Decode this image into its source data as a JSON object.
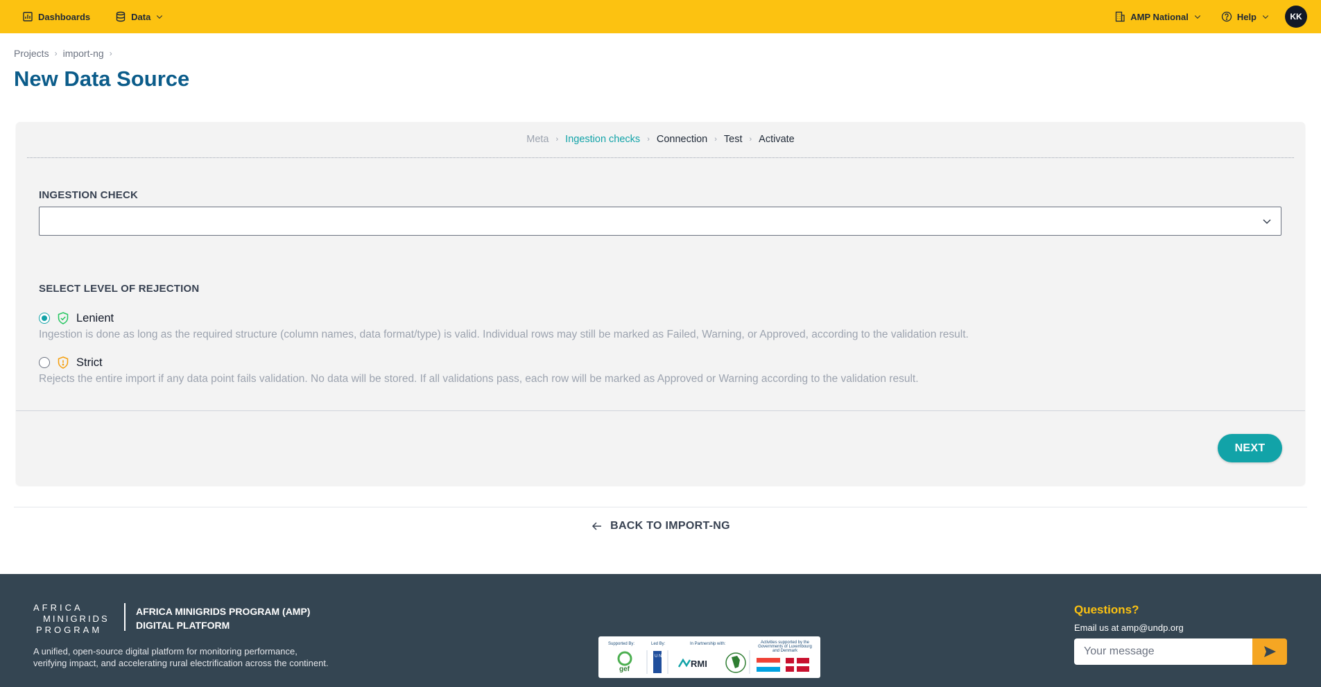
{
  "topbar": {
    "dashboards_label": "Dashboards",
    "data_label": "Data",
    "org_label": "AMP National",
    "help_label": "Help",
    "avatar_initials": "KK",
    "background_color": "#fcc211"
  },
  "breadcrumb": {
    "items": [
      "Projects",
      "import-ng"
    ]
  },
  "page": {
    "title": "New Data Source"
  },
  "steps": {
    "items": [
      "Meta",
      "Ingestion checks",
      "Connection",
      "Test",
      "Activate"
    ],
    "active_index": 1
  },
  "form": {
    "ingestion_check_label": "INGESTION CHECK",
    "ingestion_check_value": "",
    "rejection_label": "SELECT LEVEL OF REJECTION",
    "options": [
      {
        "label": "Lenient",
        "checked": true,
        "icon": "shield-check-icon",
        "description": "Ingestion is done as long as the required structure (column names, data format/type) is valid. Individual rows may still be marked as Failed, Warning, or Approved, according to the validation result."
      },
      {
        "label": "Strict",
        "checked": false,
        "icon": "shield-alert-icon",
        "description": "Rejects the entire import if any data point fails validation. No data will be stored. If all validations pass, each row will be marked as Approved or Warning according to the validation result."
      }
    ],
    "next_label": "NEXT",
    "accent_color": "#12a3a8"
  },
  "back_link": {
    "label": "BACK TO IMPORT-NG"
  },
  "footer": {
    "logo_lines": [
      "AFRICA",
      "MINIGRIDS",
      "PROGRAM"
    ],
    "org_line1": "AFRICA MINIGRIDS PROGRAM (AMP)",
    "org_line2": "DIGITAL PLATFORM",
    "tagline": "A unified, open-source digital platform for monitoring performance, verifying impact, and accelerating rural electrification across the continent.",
    "partners": {
      "supported_by": "Supported By:",
      "led_by": "Led By:",
      "partnership": "In Partnership with:",
      "activities": "Activities supported by the Governments of Luxembourg and Denmark",
      "gef": "gef",
      "undp": "U N D P",
      "rmi": "RMI"
    },
    "questions_title": "Questions?",
    "email_line": "Email us at amp@undp.org",
    "message_placeholder": "Your message",
    "background_color": "#344552"
  }
}
